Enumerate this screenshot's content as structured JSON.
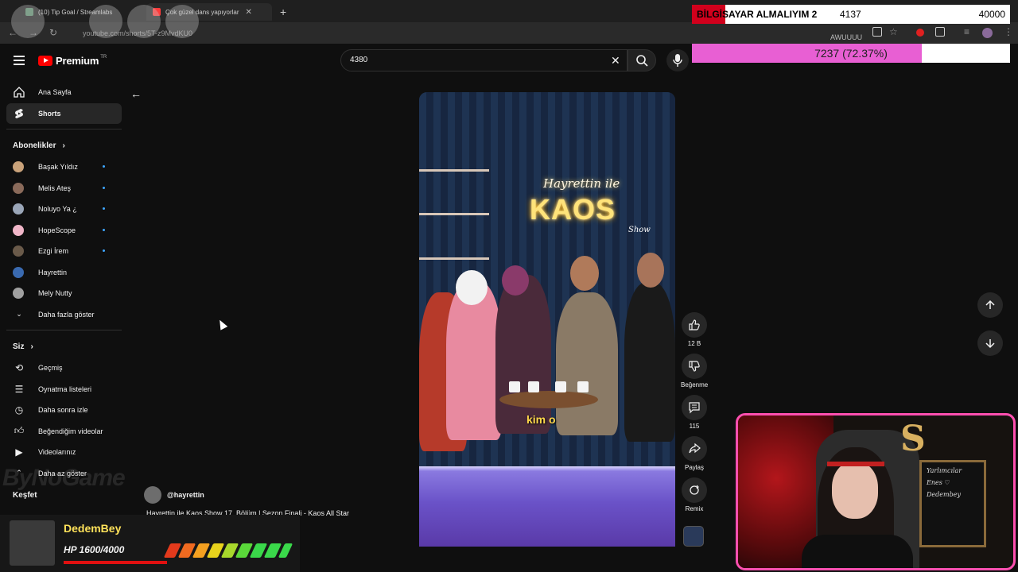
{
  "browser": {
    "tabs": [
      {
        "label": "(10) Tip Goal / Streamlabs",
        "active": false
      },
      {
        "label": "Çok güzel dans yapıyorlar",
        "active": true
      }
    ],
    "url": "youtube.com/shorts/5T-z9MvdKU0"
  },
  "overlay": {
    "goal_title": "BİLGİSAYAR ALMALIYIM 2",
    "goal_current": "4137",
    "goal_target": "40000",
    "progress_text": "7237 (72.37%)",
    "progress_fraction": 0.7237,
    "progress_color": "#e85fd3",
    "awuu_text": "AWUUUU"
  },
  "header": {
    "brand": "Premium",
    "region": "TR",
    "search_value": "4380"
  },
  "sidebar": {
    "main": [
      {
        "label": "Ana Sayfa",
        "icon": "home-icon"
      },
      {
        "label": "Shorts",
        "icon": "shorts-icon"
      }
    ],
    "subs_title": "Abonelikler",
    "subs": [
      {
        "label": "Başak Yıldız",
        "color": "#c9a27a"
      },
      {
        "label": "Melis Ateş",
        "color": "#8a6a5a"
      },
      {
        "label": "Noluyo Ya ¿",
        "color": "#9aa6b8"
      },
      {
        "label": "HopeScope",
        "color": "#f0b6c8"
      },
      {
        "label": "Ezgi İrem",
        "color": "#6a5a4a"
      },
      {
        "label": "Hayrettin",
        "color": "#3a6ab0"
      },
      {
        "label": "Mely Nutty",
        "color": "#a0a0a0"
      }
    ],
    "more_label": "Daha fazla göster",
    "you_title": "Siz",
    "you_items": [
      {
        "label": "Geçmiş",
        "icon": "history-icon"
      },
      {
        "label": "Oynatma listeleri",
        "icon": "playlist-icon"
      },
      {
        "label": "Daha sonra izle",
        "icon": "clock-icon"
      },
      {
        "label": "Beğendiğim videolar",
        "icon": "like-icon"
      },
      {
        "label": "Videolarınız",
        "icon": "video-icon"
      }
    ],
    "partial_label": "Daha az göster",
    "explore_title": "Keşfet"
  },
  "video": {
    "neon_line1": "Hayrettin ile",
    "neon_line2": "KAOS",
    "neon_line3": "Show",
    "caption": "kim o",
    "channel": "@hayrettin",
    "title": "Hayrettin ile Kaos Show 17. Bölüm | Sezon Finali - Kaos All Star"
  },
  "actions": {
    "like_count": "12 B",
    "dislike_label": "Beğenme",
    "comment_count": "115",
    "share_label": "Paylaş",
    "remix_label": "Remix"
  },
  "hp_overlay": {
    "name": "DedemBey",
    "hp_text": "HP 1600/4000",
    "watermark": "ByNoGame"
  },
  "webcam": {
    "board_line1": "Yarlımcılar",
    "board_line2": "Enes ♡",
    "board_line3": "Dedembey"
  }
}
